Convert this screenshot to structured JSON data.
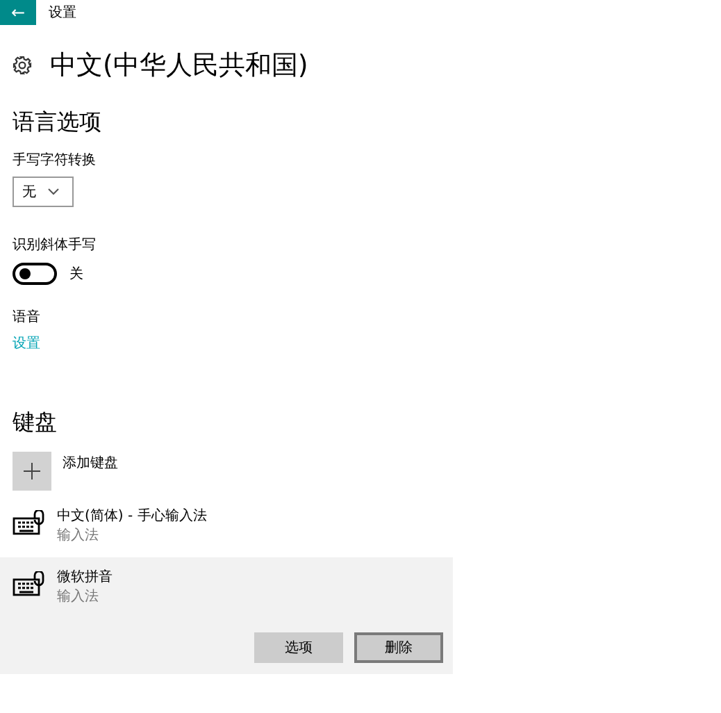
{
  "window": {
    "back_icon": "←",
    "title": "设置"
  },
  "page_title": "中文(中华人民共和国)",
  "language_options": {
    "heading": "语言选项",
    "handwriting_label": "手写字符转换",
    "handwriting_value": "无",
    "italic_label": "识别斜体手写",
    "italic_toggle": {
      "on": false,
      "state_text": "关"
    },
    "speech_label": "语音",
    "speech_link": "设置"
  },
  "keyboard": {
    "heading": "键盘",
    "add_label": "添加键盘",
    "items": [
      {
        "name": "中文(简体) - 手心输入法",
        "subtitle": "输入法",
        "selected": false
      },
      {
        "name": "微软拼音",
        "subtitle": "输入法",
        "selected": true
      }
    ],
    "buttons": [
      "选项",
      "删除"
    ]
  }
}
